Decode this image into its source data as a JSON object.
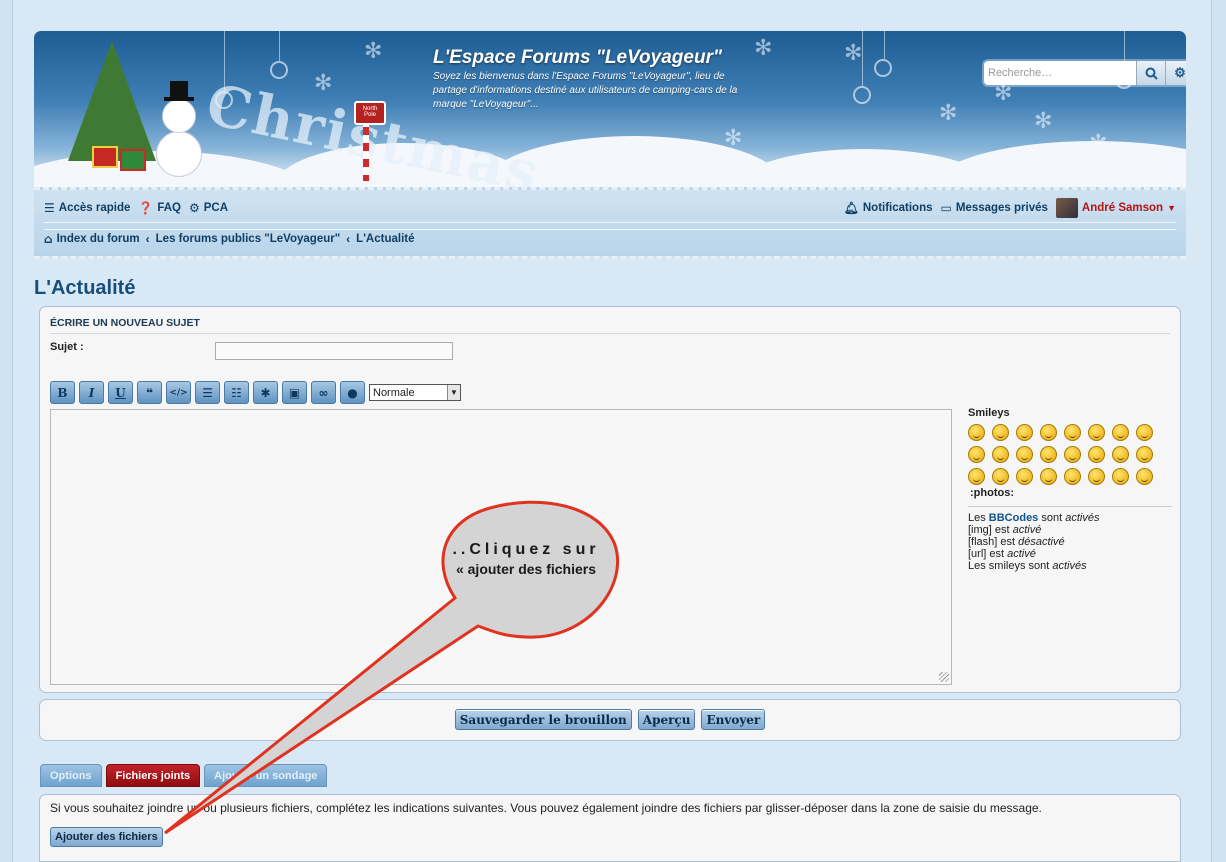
{
  "header": {
    "site_title": "L'Espace Forums \"LeVoyageur\"",
    "site_desc": "Soyez les bienvenus dans l'Espace Forums \"LeVoyageur\", lieu de partage d'informations destiné aux utilisateurs de camping-cars de la marque \"LeVoyageur\"...",
    "banner_word": "Christmas",
    "sign_text": "North Pole",
    "search_placeholder": "Recherche…"
  },
  "navbar": {
    "quick_access": "Accès rapide",
    "faq": "FAQ",
    "pca": "PCA",
    "notifications": "Notifications",
    "private_messages": "Messages privés",
    "username": "André Samson"
  },
  "breadcrumb": {
    "items": [
      "Index du forum",
      "Les forums publics \"LeVoyageur\"",
      "L'Actualité"
    ]
  },
  "page": {
    "title": "L'Actualité"
  },
  "post_form": {
    "heading": "ÉCRIRE UN NOUVEAU SUJET",
    "subject_label": "Sujet :",
    "subject_value": "",
    "font_size_selected": "Normale",
    "toolbar": {
      "bold": "B",
      "italic": "I",
      "underline": "U",
      "quote": "❝",
      "code": "</>",
      "list": "☰",
      "numbered_list": "☷",
      "list_item": "✱",
      "image": "▣",
      "url": "∞",
      "color": "●"
    }
  },
  "smileys": {
    "title": "Smileys",
    "count": 24,
    "photos_label": ":photos:"
  },
  "bbcode_info": {
    "bbcodes_prefix": "Les ",
    "bbcodes_link": "BBCodes",
    "bbcodes_mid": " sont ",
    "bbcodes_state": "activés",
    "img_prefix": "[img] est ",
    "img_state": "activé",
    "flash_prefix": "[flash] est ",
    "flash_state": "désactivé",
    "url_prefix": "[url] est ",
    "url_state": "activé",
    "smileys_prefix": "Les smileys sont ",
    "smileys_state": "activés"
  },
  "buttons": {
    "save_draft": "Sauvegarder le brouillon",
    "preview": "Aperçu",
    "submit": "Envoyer"
  },
  "tabs": {
    "options": "Options",
    "attachments": "Fichiers joints",
    "poll": "Ajouter un sondage"
  },
  "attachments": {
    "instructions": "Si vous souhaitez joindre un ou plusieurs fichiers, complétez les indications suivantes. Vous pouvez également joindre des fichiers par glisser-déposer dans la zone de saisie du message.",
    "add_button": "Ajouter des fichiers"
  },
  "annotation": {
    "line1": "..Cliquez sur",
    "line2": "« ajouter des fichiers",
    "fill_color": "#d4d4d4",
    "stroke_color": "#e0321f"
  }
}
